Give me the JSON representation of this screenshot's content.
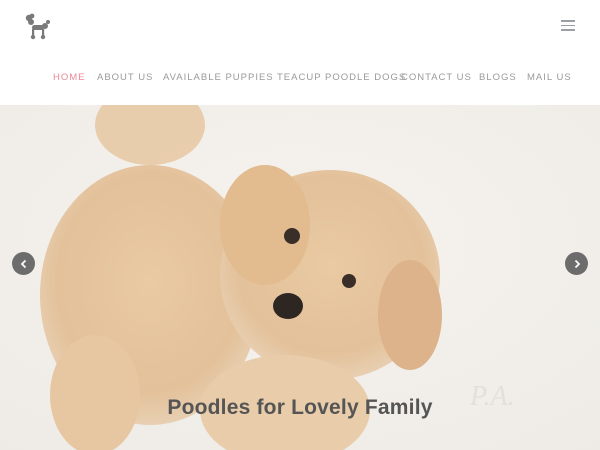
{
  "brand": {
    "logo_icon": "poodle-logo-icon",
    "accent": "#ea8a96"
  },
  "nav": {
    "items": [
      {
        "label": "HOME",
        "active": true
      },
      {
        "label": "ABOUT US"
      },
      {
        "label": "AVAILABLE PUPPIES"
      },
      {
        "label": "TEACUP POODLE DOGS"
      },
      {
        "label": "CONTACT US"
      },
      {
        "label": "BLOGS"
      },
      {
        "label": "MAIL US"
      }
    ],
    "toggle_icon": "hamburger-menu-icon"
  },
  "hero": {
    "caption": "Poodles for Lovely Family",
    "prev_icon": "chevron-left-icon",
    "next_icon": "chevron-right-icon"
  }
}
